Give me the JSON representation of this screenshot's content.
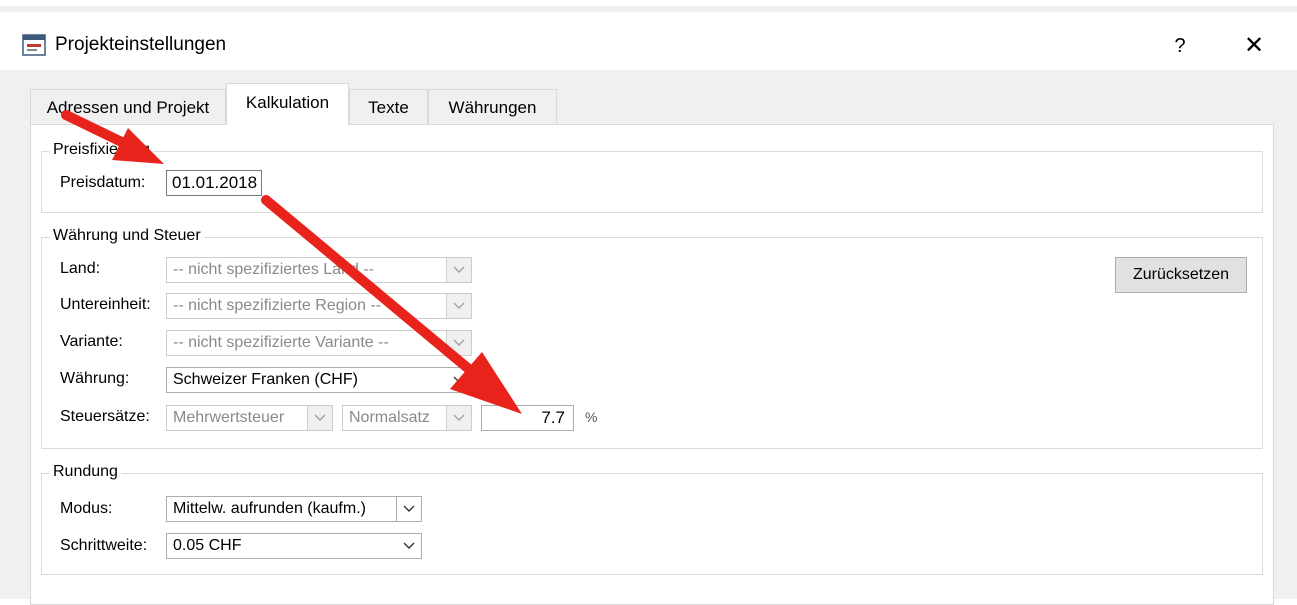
{
  "window": {
    "title": "Projekteinstellungen",
    "help_glyph": "?",
    "close_glyph": "✕"
  },
  "tabs": [
    {
      "label": "Adressen und Projekt"
    },
    {
      "label": "Kalkulation",
      "active": true
    },
    {
      "label": "Texte"
    },
    {
      "label": "Währungen"
    }
  ],
  "price_fixing": {
    "group_label": "Preisfixierung",
    "date_label": "Preisdatum:",
    "date_value": "01.01.2018"
  },
  "currency_tax": {
    "group_label": "Währung und Steuer",
    "country_label": "Land:",
    "country_value": "-- nicht spezifiziertes Land --",
    "subunit_label": "Untereinheit:",
    "subunit_value": "-- nicht spezifizierte Region --",
    "variant_label": "Variante:",
    "variant_value": "-- nicht spezifizierte Variante --",
    "currency_label": "Währung:",
    "currency_value": "Schweizer Franken (CHF)",
    "tax_label": "Steuersätze:",
    "tax_type_value": "Mehrwertsteuer",
    "tax_rate_type_value": "Normalsatz",
    "tax_rate_value": "7.7",
    "tax_rate_unit": "%",
    "reset_label": "Zurücksetzen"
  },
  "rounding": {
    "group_label": "Rundung",
    "mode_label": "Modus:",
    "mode_value": "Mittelw. aufrunden (kaufm.)",
    "step_label": "Schrittweite:",
    "step_value": "0.05 CHF"
  },
  "colors": {
    "annotation_arrow": "#e8231c",
    "window_bg": "#f0f0f0",
    "panel_bg": "#ffffff"
  },
  "icons": {
    "app": "app-icon",
    "dropdown": "chevron-down-icon"
  }
}
